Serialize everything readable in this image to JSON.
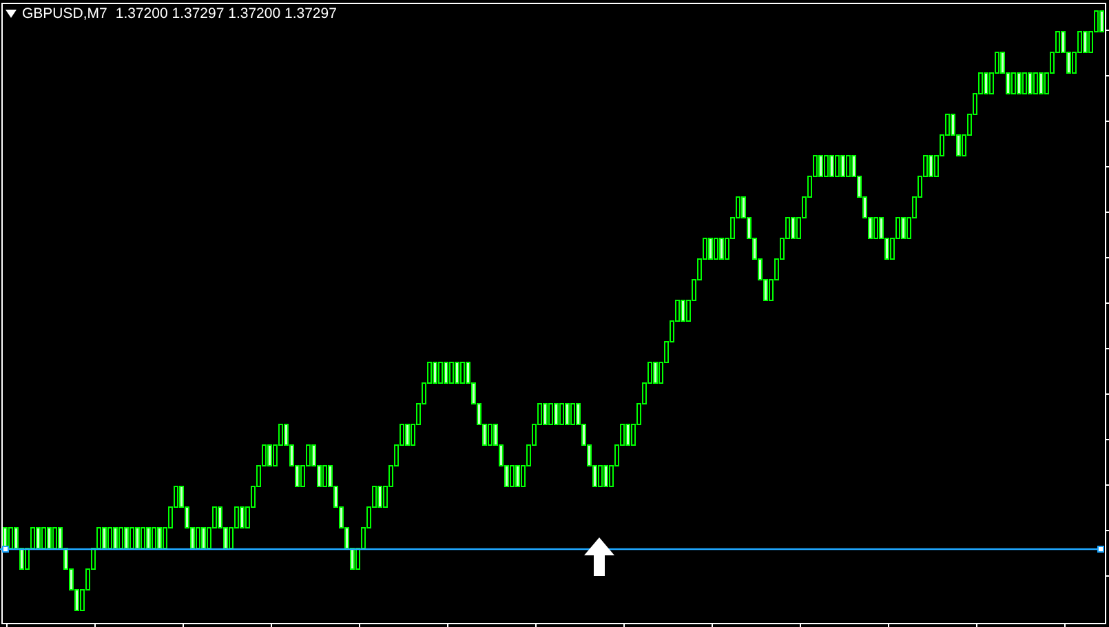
{
  "chart_header": {
    "symbol": "GBPUSD,M7",
    "prices": "1.37200 1.37297 1.37200 1.37297"
  }
}
